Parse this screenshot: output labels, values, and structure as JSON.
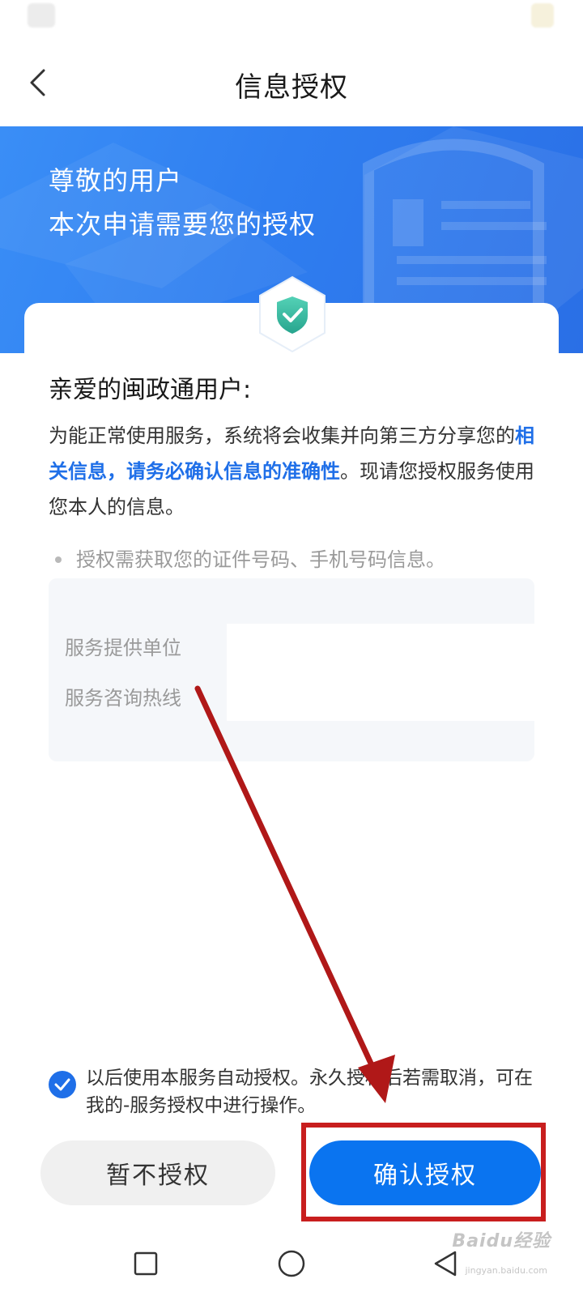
{
  "header": {
    "title": "信息授权"
  },
  "banner": {
    "line1": "尊敬的用户",
    "line2": "本次申请需要您的授权"
  },
  "content": {
    "salutation": "亲爱的闽政通用户:",
    "intro_part1": "为能正常使用服务，系统将会收集并向第三方分享您的",
    "intro_highlight": "相关信息，请务必确认信息的准确性",
    "intro_part2": "。现请您授权服务使用您本人的信息。",
    "bullet": "授权需获取您的证件号码、手机号码信息。"
  },
  "provider": {
    "label_unit": "服务提供单位",
    "label_hotline": "服务咨询热线"
  },
  "consent": {
    "checked": true,
    "text": "以后使用本服务自动授权。永久授权后若需取消，可在我的-服务授权中进行操作。"
  },
  "buttons": {
    "decline": "暂不授权",
    "confirm": "确认授权"
  },
  "watermark": {
    "brand": "Baidu经验",
    "url": "jingyan.baidu.com"
  },
  "colors": {
    "accent": "#0a74f0",
    "banner": "#2f7ef0",
    "annotation": "#c81e1e"
  }
}
